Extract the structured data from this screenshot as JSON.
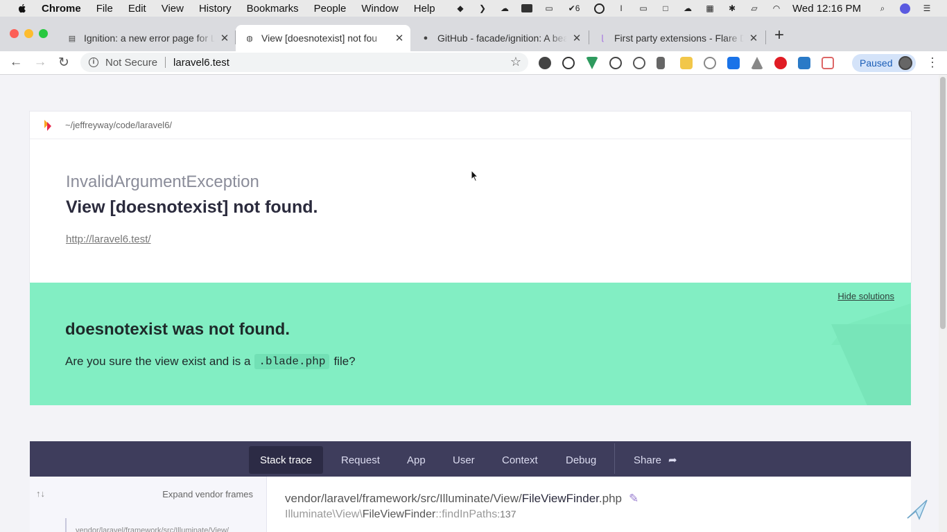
{
  "menubar": {
    "app_name": "Chrome",
    "menus": [
      "File",
      "Edit",
      "View",
      "History",
      "Bookmarks",
      "People",
      "Window",
      "Help"
    ],
    "tray_badge": "6",
    "clock": "Wed 12:16 PM"
  },
  "tabs": [
    {
      "title": "Ignition: a new error page for L",
      "active": false
    },
    {
      "title": "View [doesnotexist] not fou",
      "active": true
    },
    {
      "title": "GitHub - facade/ignition: A bea",
      "active": false
    },
    {
      "title": "First party extensions - Flare D",
      "active": false
    }
  ],
  "toolbar": {
    "security_label": "Not Secure",
    "url": "laravel6.test",
    "profile_label": "Paused"
  },
  "page": {
    "project_path": "~/jeffreyway/code/laravel6/",
    "exception_class": "InvalidArgumentException",
    "exception_message": "View [doesnotexist] not found.",
    "request_url": "http://laravel6.test/",
    "solution": {
      "hide_label": "Hide solutions",
      "title": "doesnotexist was not found.",
      "desc_before": "Are you sure the view exist and is a",
      "desc_code": ".blade.php",
      "desc_after": "file?"
    },
    "nav_tabs": [
      "Stack trace",
      "Request",
      "App",
      "User",
      "Context",
      "Debug"
    ],
    "share_label": "Share",
    "frames": {
      "expand_label": "Expand vendor frames",
      "first_frame": "vendor/laravel/framework/src/Illuminate/View/"
    },
    "detail": {
      "file_dir": "vendor/laravel/framework/src/Illuminate/View/",
      "file_name": "FileViewFinder",
      "file_ext": ".php",
      "class_ns": "Illuminate\\View\\",
      "class_name": "FileViewFinder",
      "method": "::findInPaths",
      "line": ":137"
    }
  },
  "colors": {
    "solution_bg": "#82eec3",
    "nav_bg": "#3e3d5c",
    "profile_chip": "#d4e3f9"
  }
}
